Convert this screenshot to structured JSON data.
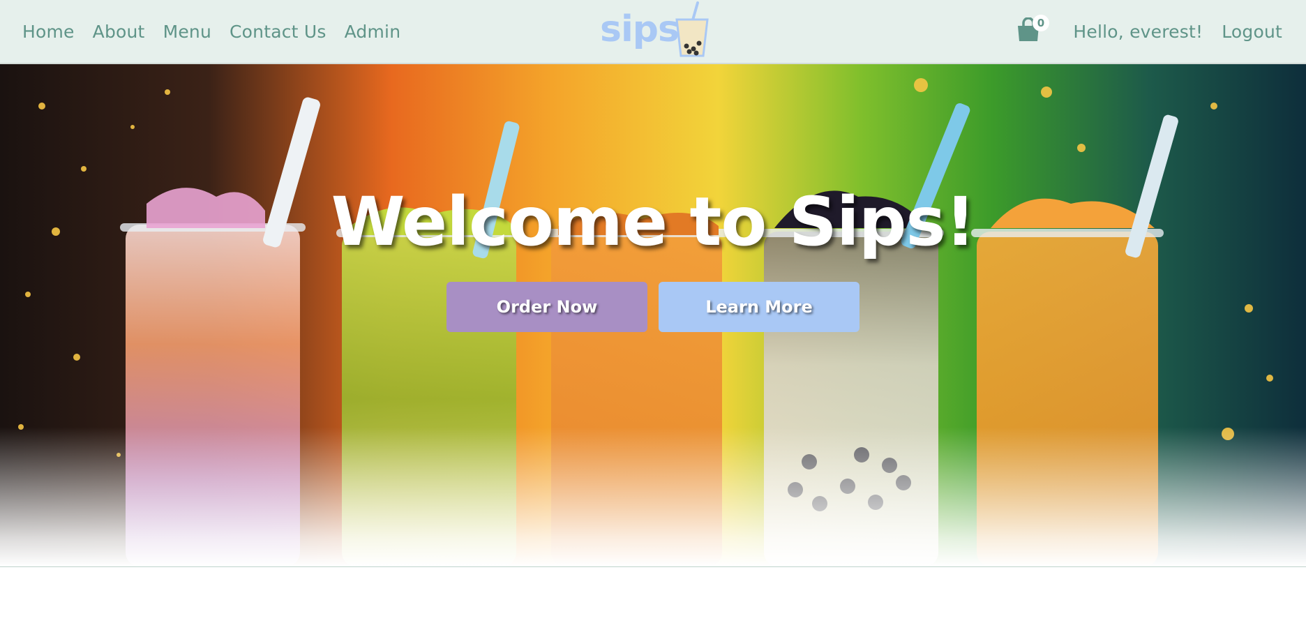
{
  "nav": {
    "left_links": [
      {
        "label": "Home"
      },
      {
        "label": "About"
      },
      {
        "label": "Menu"
      },
      {
        "label": "Contact Us"
      },
      {
        "label": "Admin"
      }
    ],
    "logo_text": "sips",
    "cart": {
      "icon": "shopping-bag-icon",
      "count": "0"
    },
    "greeting": "Hello, everest!",
    "logout_label": "Logout"
  },
  "hero": {
    "title": "Welcome to Sips!",
    "order_button": "Order Now",
    "learn_button": "Learn More"
  },
  "colors": {
    "nav_bg": "#e6f0ec",
    "nav_text": "#5f9488",
    "logo": "#a9c8f5",
    "order_button": "#a88fc4",
    "learn_button": "#a9c8f5"
  }
}
